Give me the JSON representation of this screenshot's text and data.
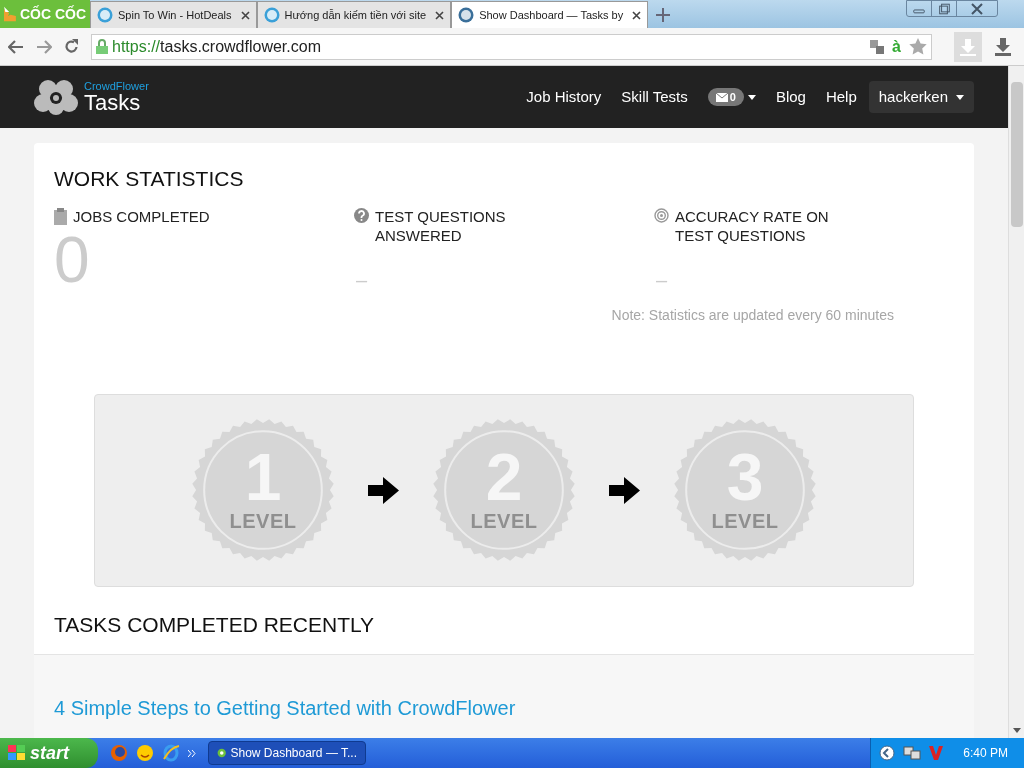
{
  "browser": {
    "logo": "CỐC CỐC",
    "tabs": [
      {
        "title": "Spin To Win - HotDeals",
        "selected": false
      },
      {
        "title": "Hướng dẫn kiếm tiền với site",
        "selected": false
      },
      {
        "title": "Show Dashboard — Tasks by",
        "selected": true
      }
    ],
    "url_scheme": "https://",
    "url_host": "tasks.crowdflower.com",
    "translate_letter": "à"
  },
  "header": {
    "brand_small": "CrowdFlower",
    "brand": "Tasks",
    "nav": [
      "Job History",
      "Skill Tests"
    ],
    "messages_count": "0",
    "nav_after": [
      "Blog",
      "Help"
    ],
    "user": "hackerken"
  },
  "work_statistics": {
    "title": "WORK STATISTICS",
    "stats": [
      {
        "kind": "clipboard",
        "label": "JOBS COMPLETED",
        "value": "0"
      },
      {
        "kind": "question",
        "label": "TEST QUESTIONS ANSWERED",
        "value": "–"
      },
      {
        "kind": "target",
        "label": "ACCURACY RATE ON TEST QUESTIONS",
        "value": "–"
      }
    ],
    "note": "Note: Statistics are updated every 60 minutes"
  },
  "levels": [
    {
      "number": "1",
      "label": "LEVEL"
    },
    {
      "number": "2",
      "label": "LEVEL"
    },
    {
      "number": "3",
      "label": "LEVEL"
    }
  ],
  "tasks_recent": {
    "title": "TASKS COMPLETED RECENTLY",
    "link": "4 Simple Steps to Getting Started with CrowdFlower"
  },
  "taskbar": {
    "start": "start",
    "task": "Show Dashboard — T...",
    "clock": "6:40 PM"
  }
}
